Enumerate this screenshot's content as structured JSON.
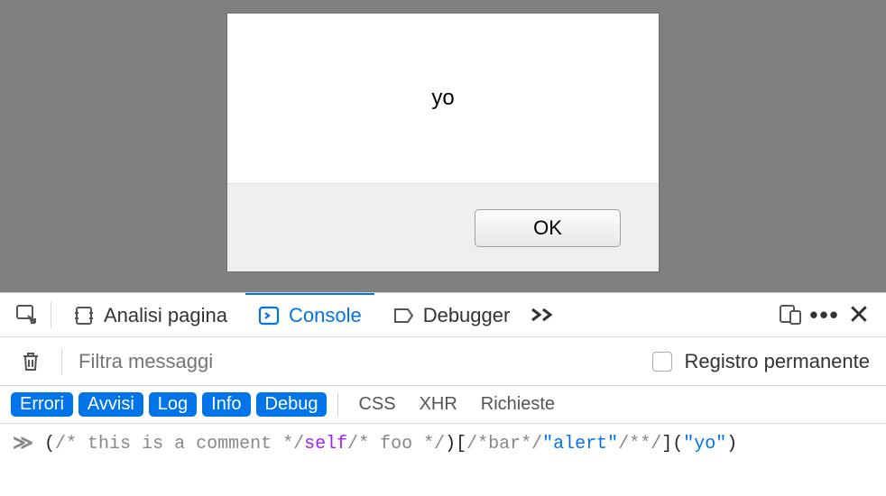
{
  "alert": {
    "message": "yo",
    "ok_label": "OK"
  },
  "devtools": {
    "tabs": {
      "inspector": "Analisi pagina",
      "console": "Console",
      "debugger": "Debugger"
    },
    "filter": {
      "placeholder": "Filtra messaggi",
      "persist_label": "Registro permanente"
    },
    "pills": {
      "errors": "Errori",
      "warnings": "Avvisi",
      "log": "Log",
      "info": "Info",
      "debug": "Debug",
      "css": "CSS",
      "xhr": "XHR",
      "requests": "Richieste"
    },
    "input": {
      "prompt": "≫",
      "tokens": [
        {
          "cls": "c-plain",
          "text": "("
        },
        {
          "cls": "c-comment",
          "text": "/* this is a comment */"
        },
        {
          "cls": "c-keyword",
          "text": "self"
        },
        {
          "cls": "c-comment",
          "text": "/* foo */"
        },
        {
          "cls": "c-plain",
          "text": ")["
        },
        {
          "cls": "c-comment",
          "text": "/*bar*/"
        },
        {
          "cls": "c-string",
          "text": "\"alert\""
        },
        {
          "cls": "c-comment",
          "text": "/**/"
        },
        {
          "cls": "c-plain",
          "text": "]("
        },
        {
          "cls": "c-string",
          "text": "\"yo\""
        },
        {
          "cls": "c-plain",
          "text": ")"
        }
      ]
    }
  }
}
